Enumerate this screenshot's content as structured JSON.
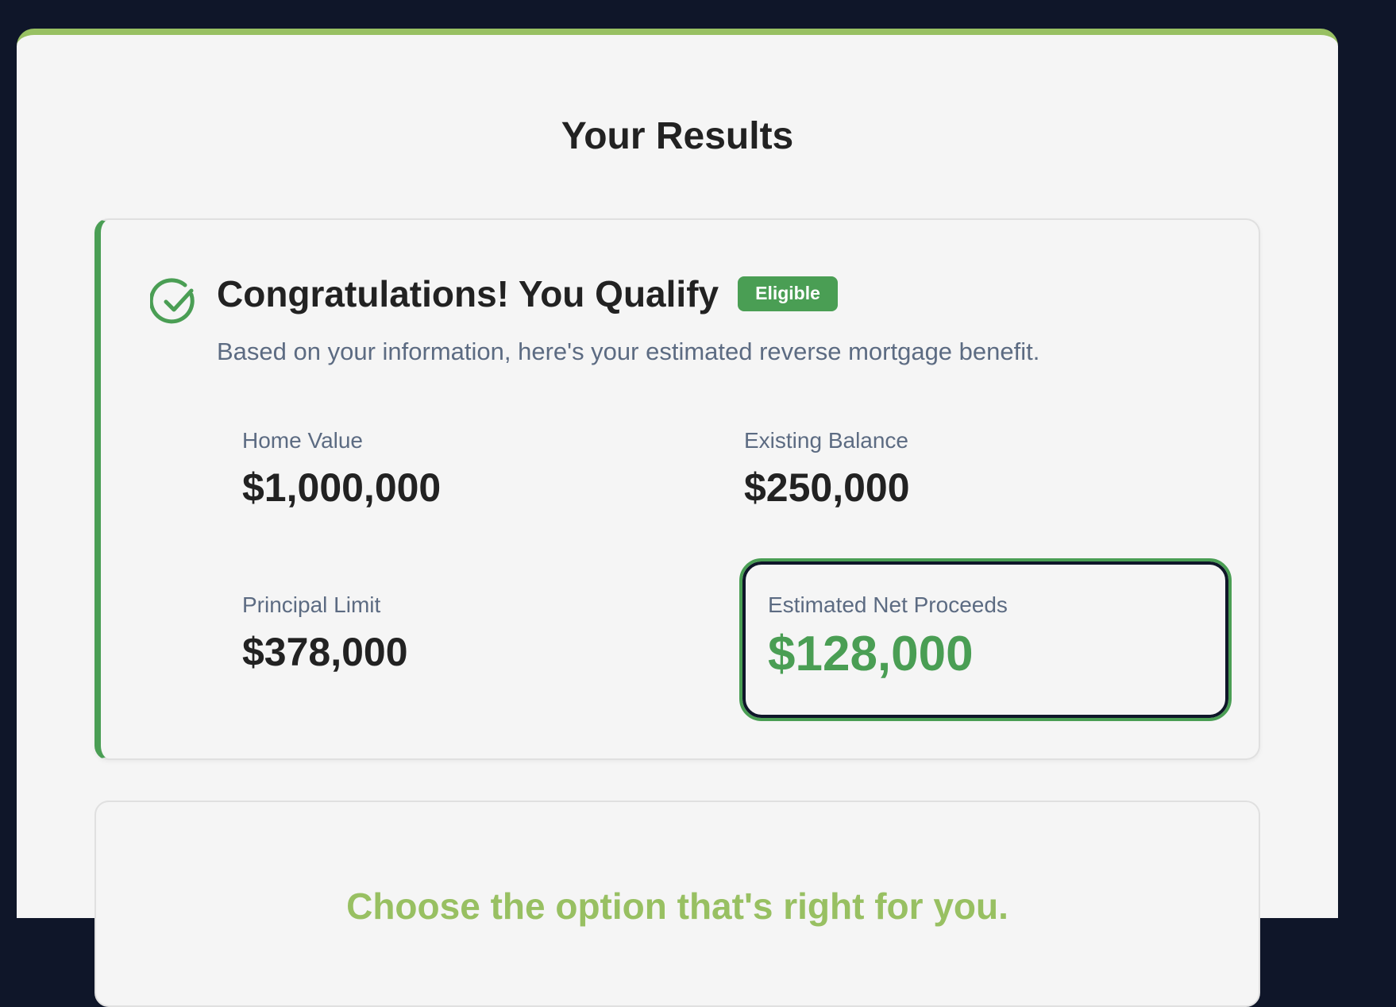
{
  "page": {
    "title": "Your Results"
  },
  "result": {
    "title": "Congratulations! You Qualify",
    "badge": "Eligible",
    "subtitle": "Based on your information, here's your estimated reverse mortgage benefit.",
    "stats": {
      "home_value": {
        "label": "Home Value",
        "value": "$1,000,000"
      },
      "existing_balance": {
        "label": "Existing Balance",
        "value": "$250,000"
      },
      "principal_limit": {
        "label": "Principal Limit",
        "value": "$378,000"
      },
      "net_proceeds": {
        "label": "Estimated Net Proceeds",
        "value": "$128,000"
      }
    }
  },
  "options": {
    "title": "Choose the option that's right for you."
  },
  "colors": {
    "background": "#0f1629",
    "accent_green": "#4a9e54",
    "light_green": "#98c062",
    "panel": "#f5f5f5"
  },
  "icons": {
    "qualify": "check-circle-icon"
  }
}
